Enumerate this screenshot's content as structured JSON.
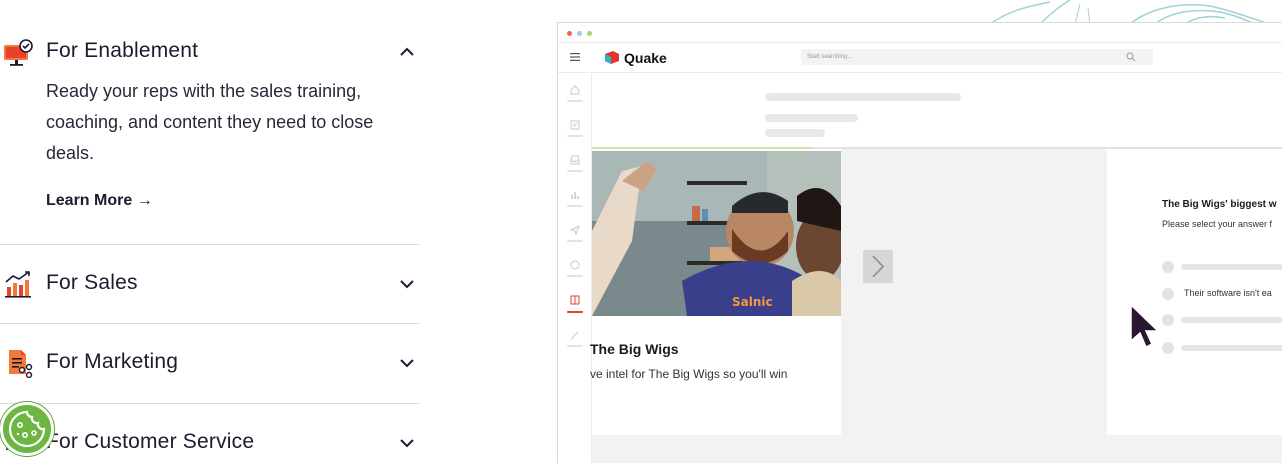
{
  "accordion": {
    "items": [
      {
        "title": "For Enablement",
        "expanded": true,
        "description": "Ready your reps with the sales training, coaching, and content they need to close deals.",
        "link_label": "Learn More →"
      },
      {
        "title": "For Sales",
        "expanded": false
      },
      {
        "title": "For Marketing",
        "expanded": false
      },
      {
        "title": "For Customer Service",
        "expanded": false
      }
    ]
  },
  "colors": {
    "accent": "#e8412c",
    "brand_red": "#e3342f",
    "cookie_green": "#6db644"
  },
  "mockup": {
    "brand_name": "Quake",
    "search_placeholder": "Start searching...",
    "card": {
      "title": "The Big Wigs",
      "text": "ve intel for The Big Wigs so you'll win"
    },
    "quiz": {
      "title": "The Big Wigs' biggest w",
      "subtitle": "Please select your answer f",
      "option_text": "Their software isn't ea"
    }
  }
}
